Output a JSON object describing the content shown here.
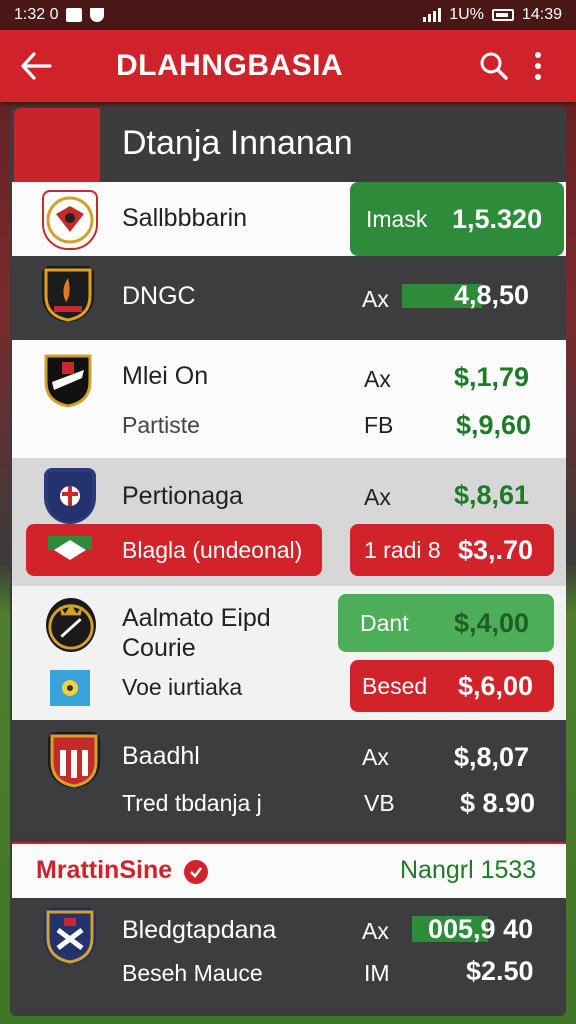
{
  "status_bar": {
    "time": "1:32 0",
    "battery_pct": "1U%",
    "clock_right": "14:39"
  },
  "app_bar": {
    "title": "DLAHNGBASIA"
  },
  "section": {
    "title": "Dtanja Innanan"
  },
  "rows": [
    {
      "team": "Sallbbbarin",
      "market": "Imask",
      "odds": "1,5.320"
    },
    {
      "team": "DNGC",
      "market": "Ax",
      "odds": "4,8,50"
    },
    {
      "team": "Mlei On",
      "market": "Ax",
      "odds": "$,1,79",
      "sub": "Partiste",
      "sub_market": "FB",
      "sub_odds": "$,9,60"
    },
    {
      "team": "Pertionaga",
      "market": "Ax",
      "odds": "$,8,61",
      "promo_label": "Blagla (undeonal)",
      "promo_market": "1 radi 8",
      "promo_odds": "$3,.70"
    },
    {
      "team_line1": "Aalmato Eipd",
      "team_line2": "Courie",
      "btn1_label": "Dant",
      "btn1_odds": "$,4,00",
      "sub": "Voe iurtiaka",
      "btn2_label": "Besed",
      "btn2_odds": "$,6,00"
    },
    {
      "team": "Baadhl",
      "market": "Ax",
      "odds": "$,8,07",
      "sub": "Tred tbdanja j",
      "sub_market": "VB",
      "sub_odds": "$ 8.90"
    }
  ],
  "footer_section": {
    "title": "MrattinSine",
    "right": "Nangrl 1533"
  },
  "last_row": {
    "team": "Bledgtapdana",
    "market": "Ax",
    "odds": "005,9 40",
    "sub": "Beseh Mauce",
    "sub_market": "IM",
    "sub_odds": "$2.50"
  },
  "colors": {
    "primary": "#d0222a",
    "green": "#2e8b3a",
    "panel": "#3c3c3e"
  },
  "icons": [
    "back-arrow-icon",
    "search-icon",
    "more-vert-icon",
    "check-icon"
  ]
}
